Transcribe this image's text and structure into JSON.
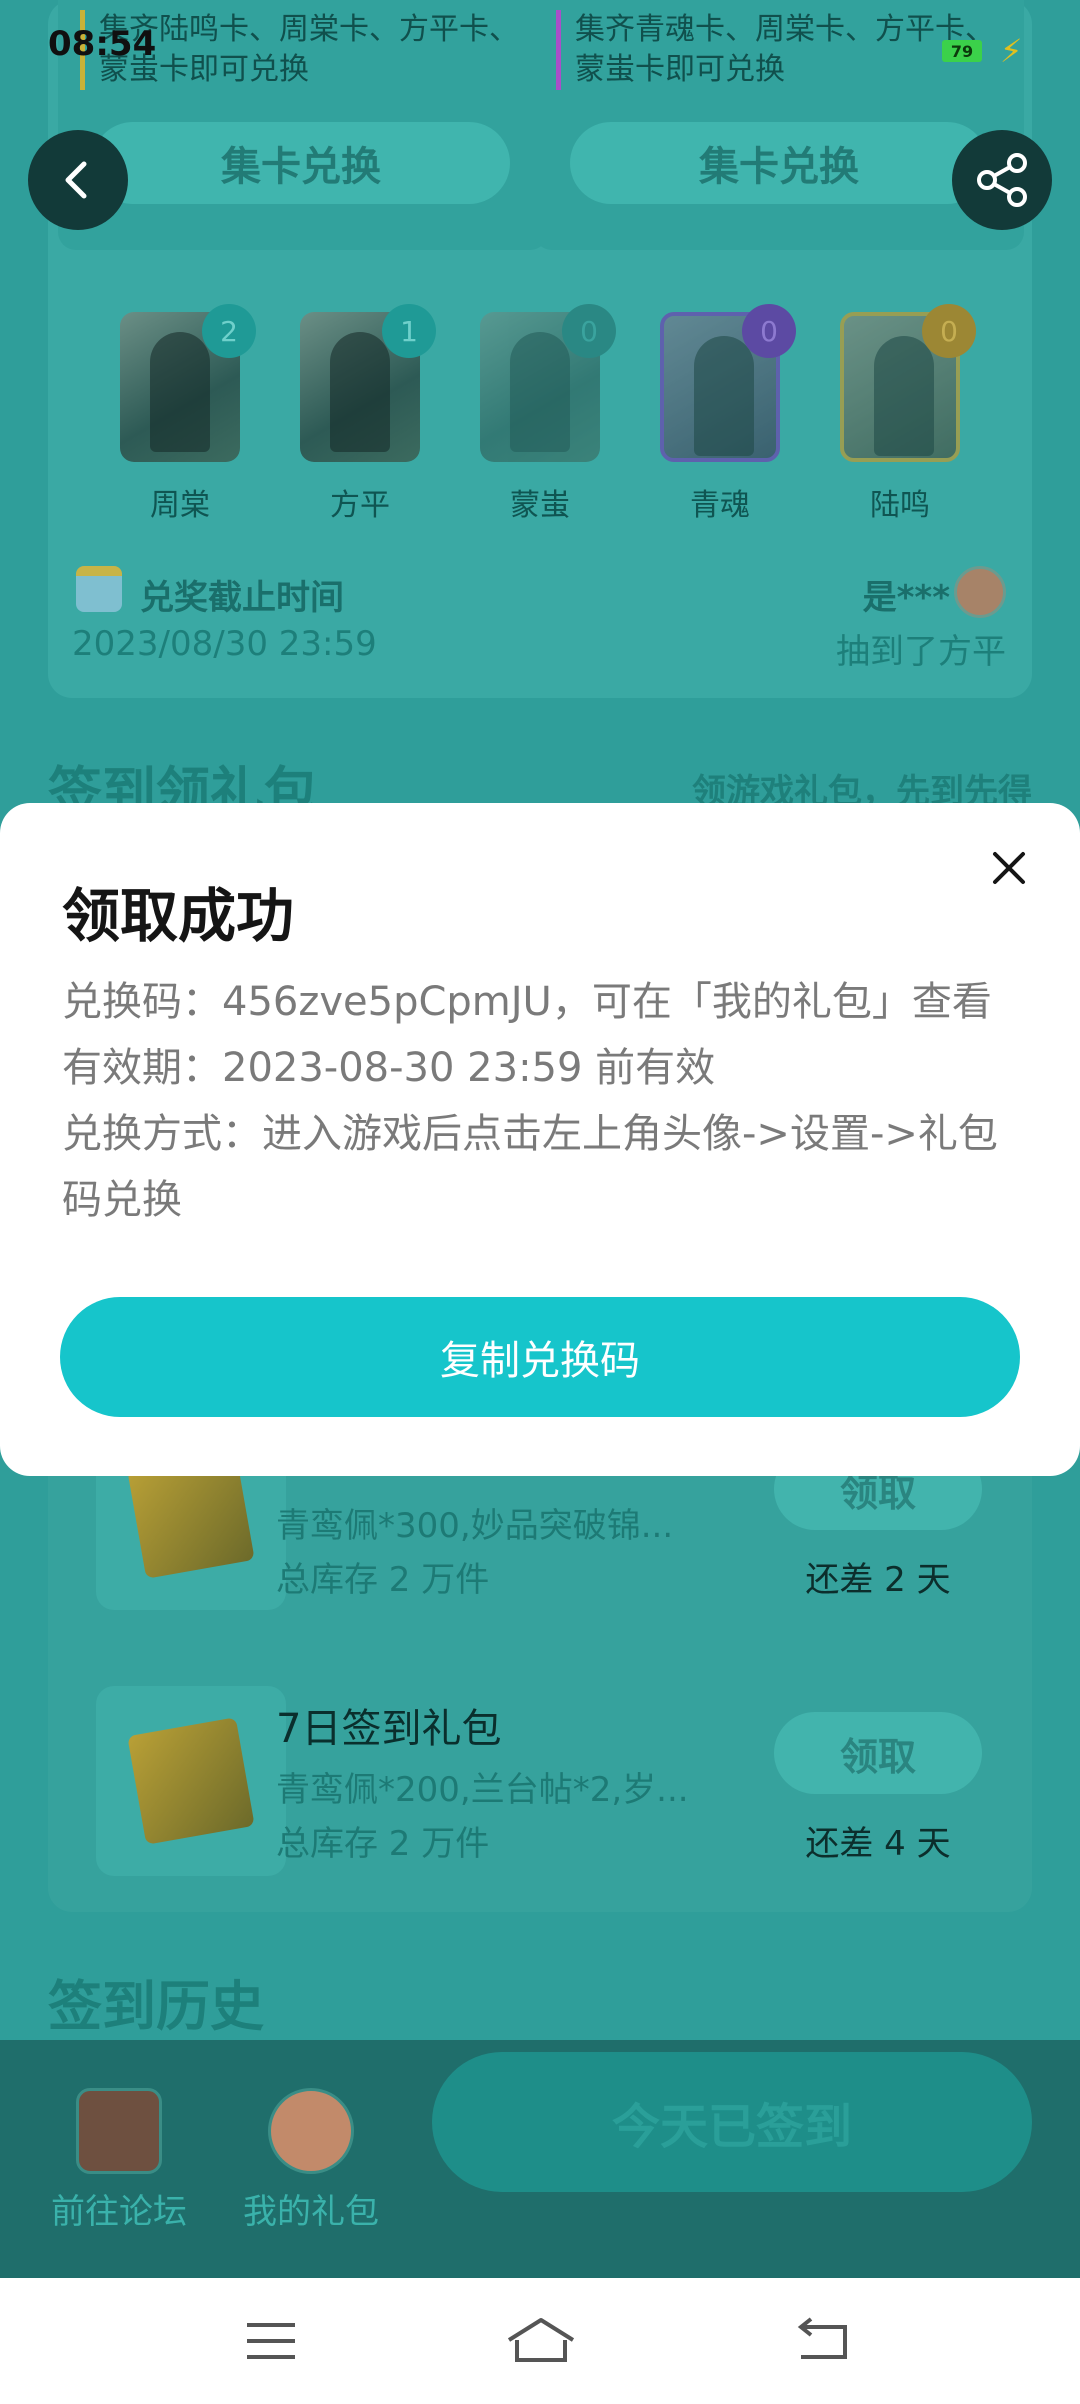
{
  "status_bar": {
    "time": "08:54",
    "battery": "79"
  },
  "exchange": [
    {
      "text": "集齐陆鸣卡、周棠卡、方平卡、蒙蚩卡即可兑换",
      "button": "集卡兑换"
    },
    {
      "text": "集齐青魂卡、周棠卡、方平卡、蒙蚩卡即可兑换",
      "button": "集卡兑换"
    }
  ],
  "cards": [
    {
      "name": "周棠",
      "count": "2"
    },
    {
      "name": "方平",
      "count": "1"
    },
    {
      "name": "蒙蚩",
      "count": "0"
    },
    {
      "name": "青魂",
      "count": "0"
    },
    {
      "name": "陆鸣",
      "count": "0"
    }
  ],
  "deadline": {
    "label": "兑奖截止时间",
    "date": "2023/08/30 23:59"
  },
  "winner": {
    "name": "是***",
    "text": "抽到了方平"
  },
  "sign_section": {
    "title": "签到领礼包",
    "subtitle": "领游戏礼包，先到先得"
  },
  "gifts": [
    {
      "title": "",
      "desc": "青鸾佩*300,妙品突破锦...",
      "stock": "总库存 2 万件",
      "button": "领取",
      "days_left": "还差 2 天"
    },
    {
      "title": "7日签到礼包",
      "desc": "青鸾佩*200,兰台帖*2,岁...",
      "stock": "总库存 2 万件",
      "button": "领取",
      "days_left": "还差 4 天"
    }
  ],
  "history_title": "签到历史",
  "actions": [
    {
      "label": "前往论坛"
    },
    {
      "label": "我的礼包"
    }
  ],
  "signed_button": "今天已签到",
  "modal": {
    "title": "领取成功",
    "code_line": "兑换码：456zve5pCpmJU，可在「我的礼包」查看",
    "valid_line": "有效期：2023-08-30 23:59 前有效",
    "method_line": "兑换方式：进入游戏后点击左上角头像->设置->礼包码兑换",
    "copy_button": "复制兑换码"
  },
  "colors": {
    "accent": "#16c5cb",
    "overlay_bg": "#2f9e9a"
  }
}
